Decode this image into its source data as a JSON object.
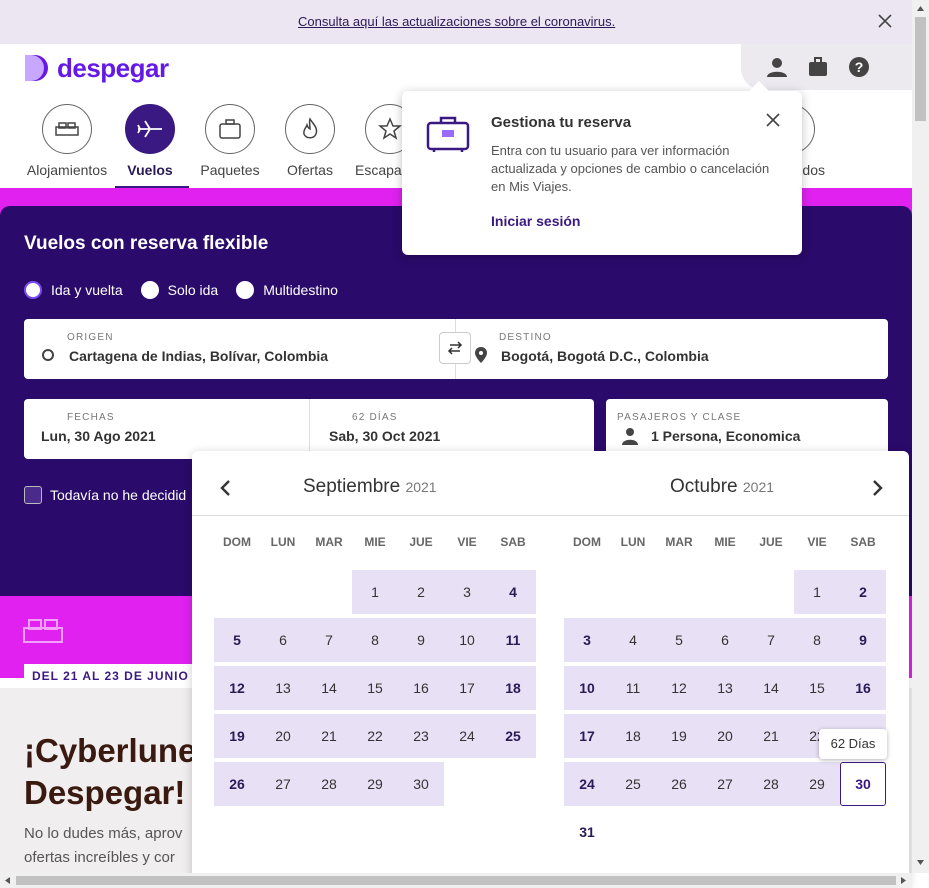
{
  "banner": {
    "link": "Consulta aquí las actualizaciones sobre el coronavirus."
  },
  "brand": {
    "name": "despegar",
    "color": "#6419e6"
  },
  "nav": {
    "items": [
      {
        "label": "Alojamientos",
        "icon": "bed-icon"
      },
      {
        "label": "Vuelos",
        "icon": "airplane-icon",
        "active": true
      },
      {
        "label": "Paquetes",
        "icon": "suitcase-icon"
      },
      {
        "label": "Ofertas",
        "icon": "flame-icon"
      },
      {
        "label": "Escapa",
        "icon": "star-icon"
      },
      {
        "label": "dos",
        "icon": "more-icon"
      }
    ]
  },
  "popup": {
    "title": "Gestiona tu reserva",
    "body": "Entra con tu usuario para ver información actualizada y opciones de cambio o cancelación en Mis Viajes.",
    "link": "Iniciar sesión"
  },
  "form": {
    "title": "Vuelos con reserva flexible",
    "trip_types": [
      "Ida y vuelta",
      "Solo ida",
      "Multidestino"
    ],
    "origin_label": "ORIGEN",
    "origin_value": "Cartagena de Indias, Bolívar, Colombia",
    "destination_label": "DESTINO",
    "destination_value": "Bogotá, Bogotá D.C., Colombia",
    "dates_label": "FECHAS",
    "date_from": "Lun, 30 Ago 2021",
    "days_label": "62 DÍAS",
    "date_to": "Sab, 30 Oct 2021",
    "passengers_label": "PASAJEROS Y CLASE",
    "passengers_value": "1 Persona, Economica",
    "undecided": "Todavía no he decidid"
  },
  "promo": {
    "badge": "DEL 21 AL 23 DE JUNIO",
    "title_line1": "¡Cyberlunes",
    "title_line2": "Despegar!",
    "text_line1": "No lo dudes más, aprov",
    "text_line2": "ofertas increíbles y cor"
  },
  "calendar": {
    "months": [
      {
        "name": "Septiembre",
        "year": "2021"
      },
      {
        "name": "Octubre",
        "year": "2021"
      }
    ],
    "weekdays": [
      "DOM",
      "LUN",
      "MAR",
      "MIE",
      "JUE",
      "VIE",
      "SAB"
    ],
    "tooltip": "62 Días",
    "selected_day": "30"
  },
  "colors": {
    "purple_dark": "#2a0a6a",
    "magenta": "#e021f0",
    "accent": "#3a1a82"
  }
}
